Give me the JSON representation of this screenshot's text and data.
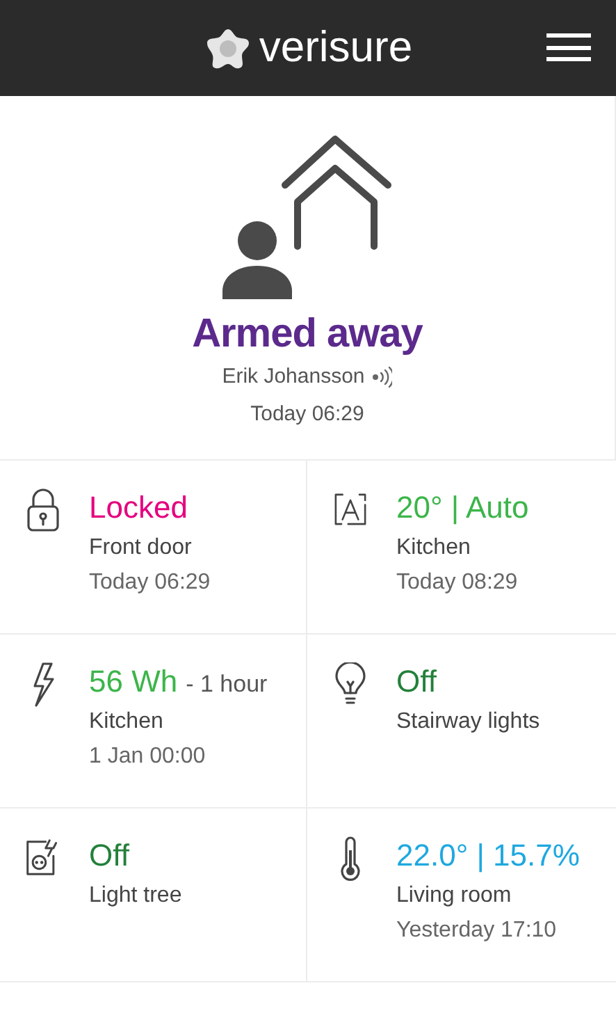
{
  "header": {
    "brand": "verisure"
  },
  "alarm": {
    "status": "Armed away",
    "user": "Erik Johansson",
    "time": "Today 06:29"
  },
  "tiles": [
    {
      "kind": "lock",
      "status": "Locked",
      "color": "#e5007e",
      "label": "Front door",
      "time": "Today 06:29"
    },
    {
      "kind": "climate",
      "status": "20° | Auto",
      "color": "#3cb54a",
      "label": "Kitchen",
      "time": "Today 08:29"
    },
    {
      "kind": "energy",
      "status": "56 Wh",
      "suffix": "- 1 hour",
      "color": "#3cb54a",
      "label": "Kitchen",
      "time": "1 Jan 00:00"
    },
    {
      "kind": "bulb",
      "status": "Off",
      "color": "#23803a",
      "label": "Stairway lights"
    },
    {
      "kind": "plug",
      "status": "Off",
      "color": "#23803a",
      "label": "Light tree"
    },
    {
      "kind": "thermometer",
      "status": "22.0° | 15.7%",
      "color": "#1ea8e0",
      "label": "Living room",
      "time": "Yesterday 17:10"
    }
  ]
}
